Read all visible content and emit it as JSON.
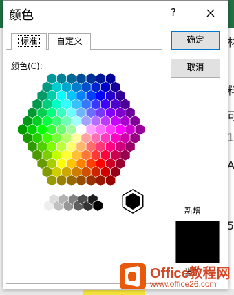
{
  "dialog": {
    "title": "颜色",
    "help_symbol": "?",
    "tabs": [
      {
        "label": "标准",
        "active": true
      },
      {
        "label": "自定义",
        "active": false
      }
    ],
    "colors_label": "颜色(C):",
    "ok_label": "确定",
    "cancel_label": "取消",
    "new_label": "新增",
    "current_label": "当前",
    "new_color": "#000000",
    "selected_color": "#000000"
  },
  "background": {
    "right_glyphs": [
      "材",
      "料",
      "可",
      "1",
      "A",
      "5"
    ]
  },
  "watermark": {
    "brand": "Office教程网",
    "url": "www.office26.com"
  },
  "colors": {
    "accent_blue": "#0078d7",
    "brand_orange": "#d24726",
    "app_green": "#217346"
  }
}
